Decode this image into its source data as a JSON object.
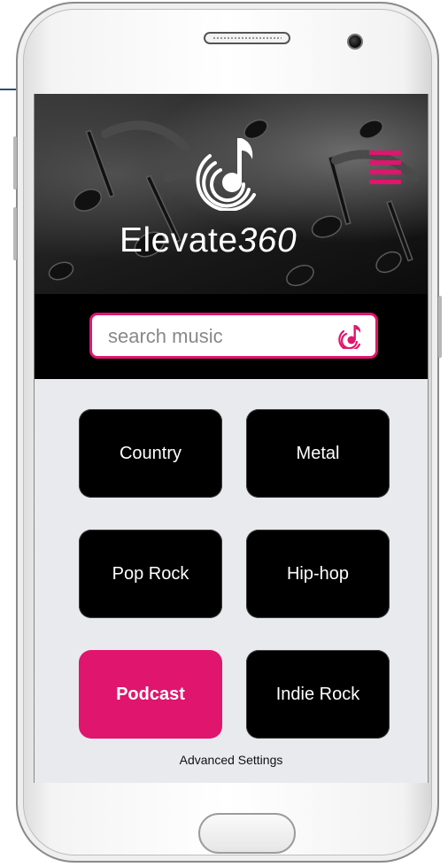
{
  "app": {
    "brand_name": "Elevate",
    "brand_suffix": "360"
  },
  "header": {
    "menu_icon": "hamburger-menu-icon",
    "logo_icon": "music-note-logo-icon"
  },
  "search": {
    "placeholder": "search music",
    "value": "",
    "icon": "music-note-search-icon"
  },
  "genres": [
    {
      "label": "Country",
      "active": false
    },
    {
      "label": "Metal",
      "active": false
    },
    {
      "label": "Pop Rock",
      "active": false
    },
    {
      "label": "Hip-hop",
      "active": false
    },
    {
      "label": "Podcast",
      "active": true
    },
    {
      "label": "Indie Rock",
      "active": false
    }
  ],
  "footer": {
    "advanced_settings_label": "Advanced Settings"
  },
  "colors": {
    "accent": "#e0156e",
    "button_bg": "#000000",
    "screen_bg": "#e9eaee"
  }
}
